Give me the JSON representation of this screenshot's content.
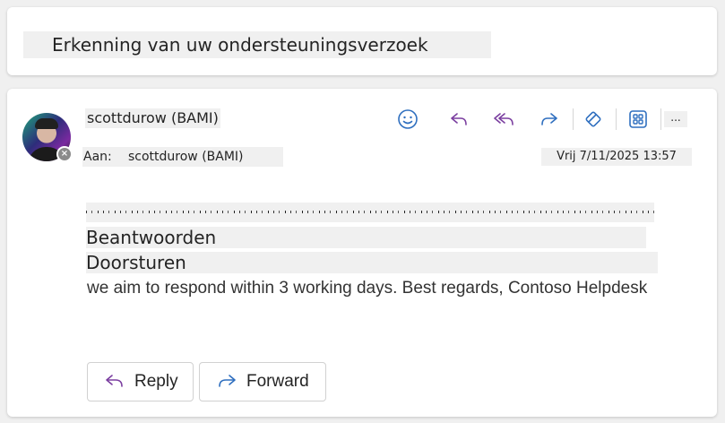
{
  "subject": "Erkenning van uw ondersteuningsverzoek",
  "message": {
    "sender": "scottdurow (BAMI)",
    "to_label": "Aan:",
    "to_value": "scottdurow (BAMI)",
    "date": "Vrij 7/11/2025 13:57",
    "reply_line": "Beantwoorden",
    "forward_line": "Doorsturen",
    "body_text": "we aim to respond within 3 working days. Best regards, Contoso Helpdesk"
  },
  "toolbar": {
    "more_label": "..."
  },
  "actions": {
    "reply_label": "Reply",
    "forward_label": "Forward"
  },
  "colors": {
    "icon_blue": "#2f6fbf",
    "icon_purple": "#7b3fa0",
    "placeholder_gray": "#f0f0f0"
  },
  "icons": [
    "emoji-icon",
    "reply-icon",
    "reply-all-icon",
    "forward-icon",
    "loop-icon",
    "apps-icon",
    "more-icon"
  ]
}
